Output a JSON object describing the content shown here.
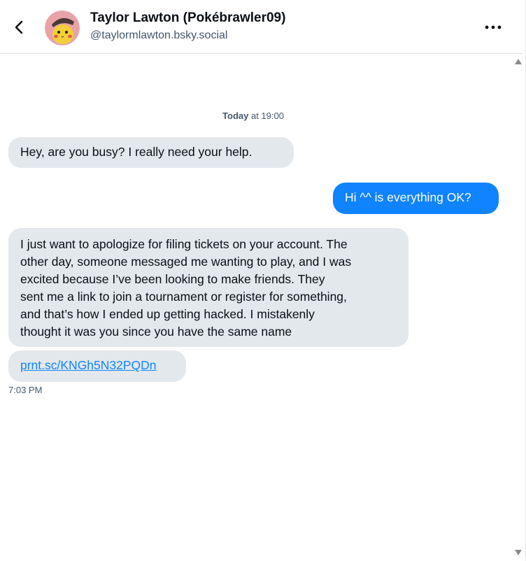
{
  "header": {
    "display_name": "Taylor Lawton (Pokébrawler09)",
    "handle": "@taylormlawton.bsky.social",
    "back_icon": "chevron-left-icon",
    "more_icon": "ellipsis-icon"
  },
  "conversation": {
    "date_separator": {
      "day": "Today",
      "time": " at 19:00"
    },
    "messages": [
      {
        "direction": "incoming",
        "text": "Hey, are you busy? I really need your help."
      },
      {
        "direction": "outgoing",
        "text": "Hi ^^ is everything OK?"
      },
      {
        "direction": "incoming",
        "lines": [
          "I just want to apologize for filing tickets on your account. The",
          "other day, someone messaged me wanting to play, and I was",
          "excited because I’ve been looking to make friends. They",
          "sent me a link to join a tournament or register for something,",
          "and that’s how I ended up getting hacked. I mistakenly",
          "thought it was you since you have the same name"
        ]
      },
      {
        "direction": "incoming",
        "link_text": "prnt.sc/KNGh5N32PQDn"
      }
    ],
    "last_timestamp": "7:03 PM"
  },
  "colors": {
    "incoming_bubble": "#e3e8ed",
    "outgoing_bubble": "#1083fe",
    "link": "#1083fe",
    "muted_text": "#42576c"
  }
}
